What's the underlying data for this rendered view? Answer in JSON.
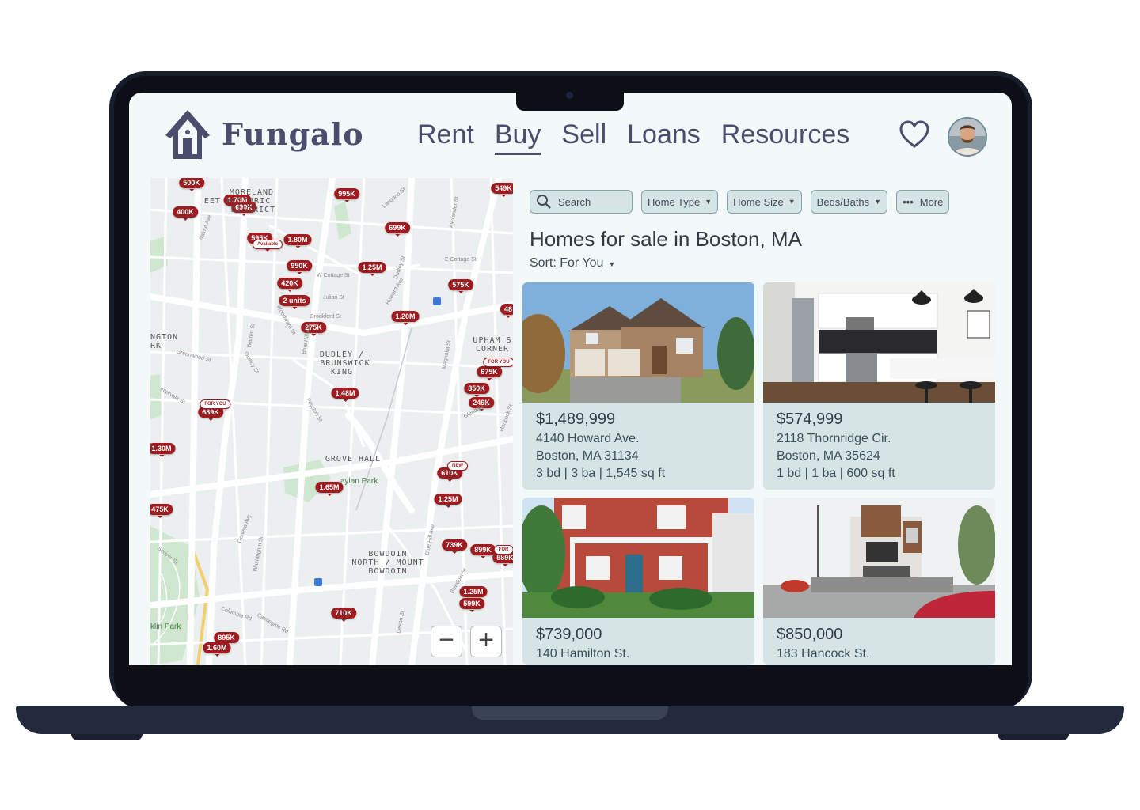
{
  "app": {
    "brand": "Fungalo"
  },
  "nav": {
    "rent": "Rent",
    "buy": "Buy",
    "sell": "Sell",
    "loans": "Loans",
    "resources": "Resources"
  },
  "filters": {
    "search": "Search",
    "home_type": "Home Type",
    "home_size": "Home Size",
    "beds_baths": "Beds/Baths",
    "more": "More"
  },
  "page": {
    "title": "Homes for sale in Boston, MA",
    "sort": "Sort: For You"
  },
  "map": {
    "zoom_out": "−",
    "zoom_in": "+",
    "areas": [
      "MORELAND",
      "EET HISTORIC",
      "DISTRICT",
      "DUDLEY /",
      "BRUNSWICK",
      "KING",
      "UPHAM'S",
      "CORNER",
      "GROVE HALL",
      "BOWDOIN",
      "NORTH / MOUNT",
      "BOWDOIN",
      "NGTON",
      "RK"
    ],
    "streets": [
      "Walnut Ave",
      "W Cottage St",
      "Julian St",
      "Brookford St",
      "Quincy St",
      "Blue Hill Ave",
      "Warren St",
      "Dudley St",
      "Howard Ave",
      "Geneva Ave",
      "Columbia Rd",
      "E Cottage St",
      "Glendale St",
      "Hancock St",
      "Seaver St",
      "Bowdoin St",
      "Washington St",
      "Fayston St",
      "Intervale St",
      "Castlegate Rd",
      "Devon St",
      "Greenwood St",
      "Langdon St",
      "Alexander St",
      "Magnolia St",
      "Blue Hill Ave",
      "Woodward St"
    ],
    "park_labels": [
      "aylan Park",
      "klin Park"
    ],
    "pins": [
      "500K",
      "1.70M",
      "699K",
      "995K",
      "549K",
      "400K",
      "699K",
      "595K",
      "1.80M",
      "Available",
      "950K",
      "1.25M",
      "420K",
      "575K",
      "2 units",
      "275K",
      "1.20M",
      "48",
      "675K",
      "FOR YOU",
      "850K",
      "249K",
      "1.48M",
      "689K",
      "FOR YOU",
      "1.30M",
      "610K",
      "NEW",
      "1.65M",
      "1.25M",
      "475K",
      "739K",
      "899K",
      "589K",
      "FOR",
      "1.25M",
      "599K",
      "710K",
      "895K",
      "1.60M"
    ]
  },
  "listings": [
    {
      "price": "$1,489,999",
      "street": "4140 Howard Ave.",
      "city": "Boston, MA 31134",
      "details": "3 bd | 3 ba | 1,545 sq ft"
    },
    {
      "price": "$574,999",
      "street": "2118 Thornridge Cir.",
      "city": "Boston, MA 35624",
      "details": "1 bd | 1 ba | 600 sq ft"
    },
    {
      "price": "$739,000",
      "street": "140 Hamilton St."
    },
    {
      "price": "$850,000",
      "street": "183 Hancock St."
    }
  ],
  "colors": {
    "accent": "#4b4d6e",
    "pin": "#9e1b1f",
    "card": "#d5e5e5",
    "screen": "#f3f9f9"
  }
}
